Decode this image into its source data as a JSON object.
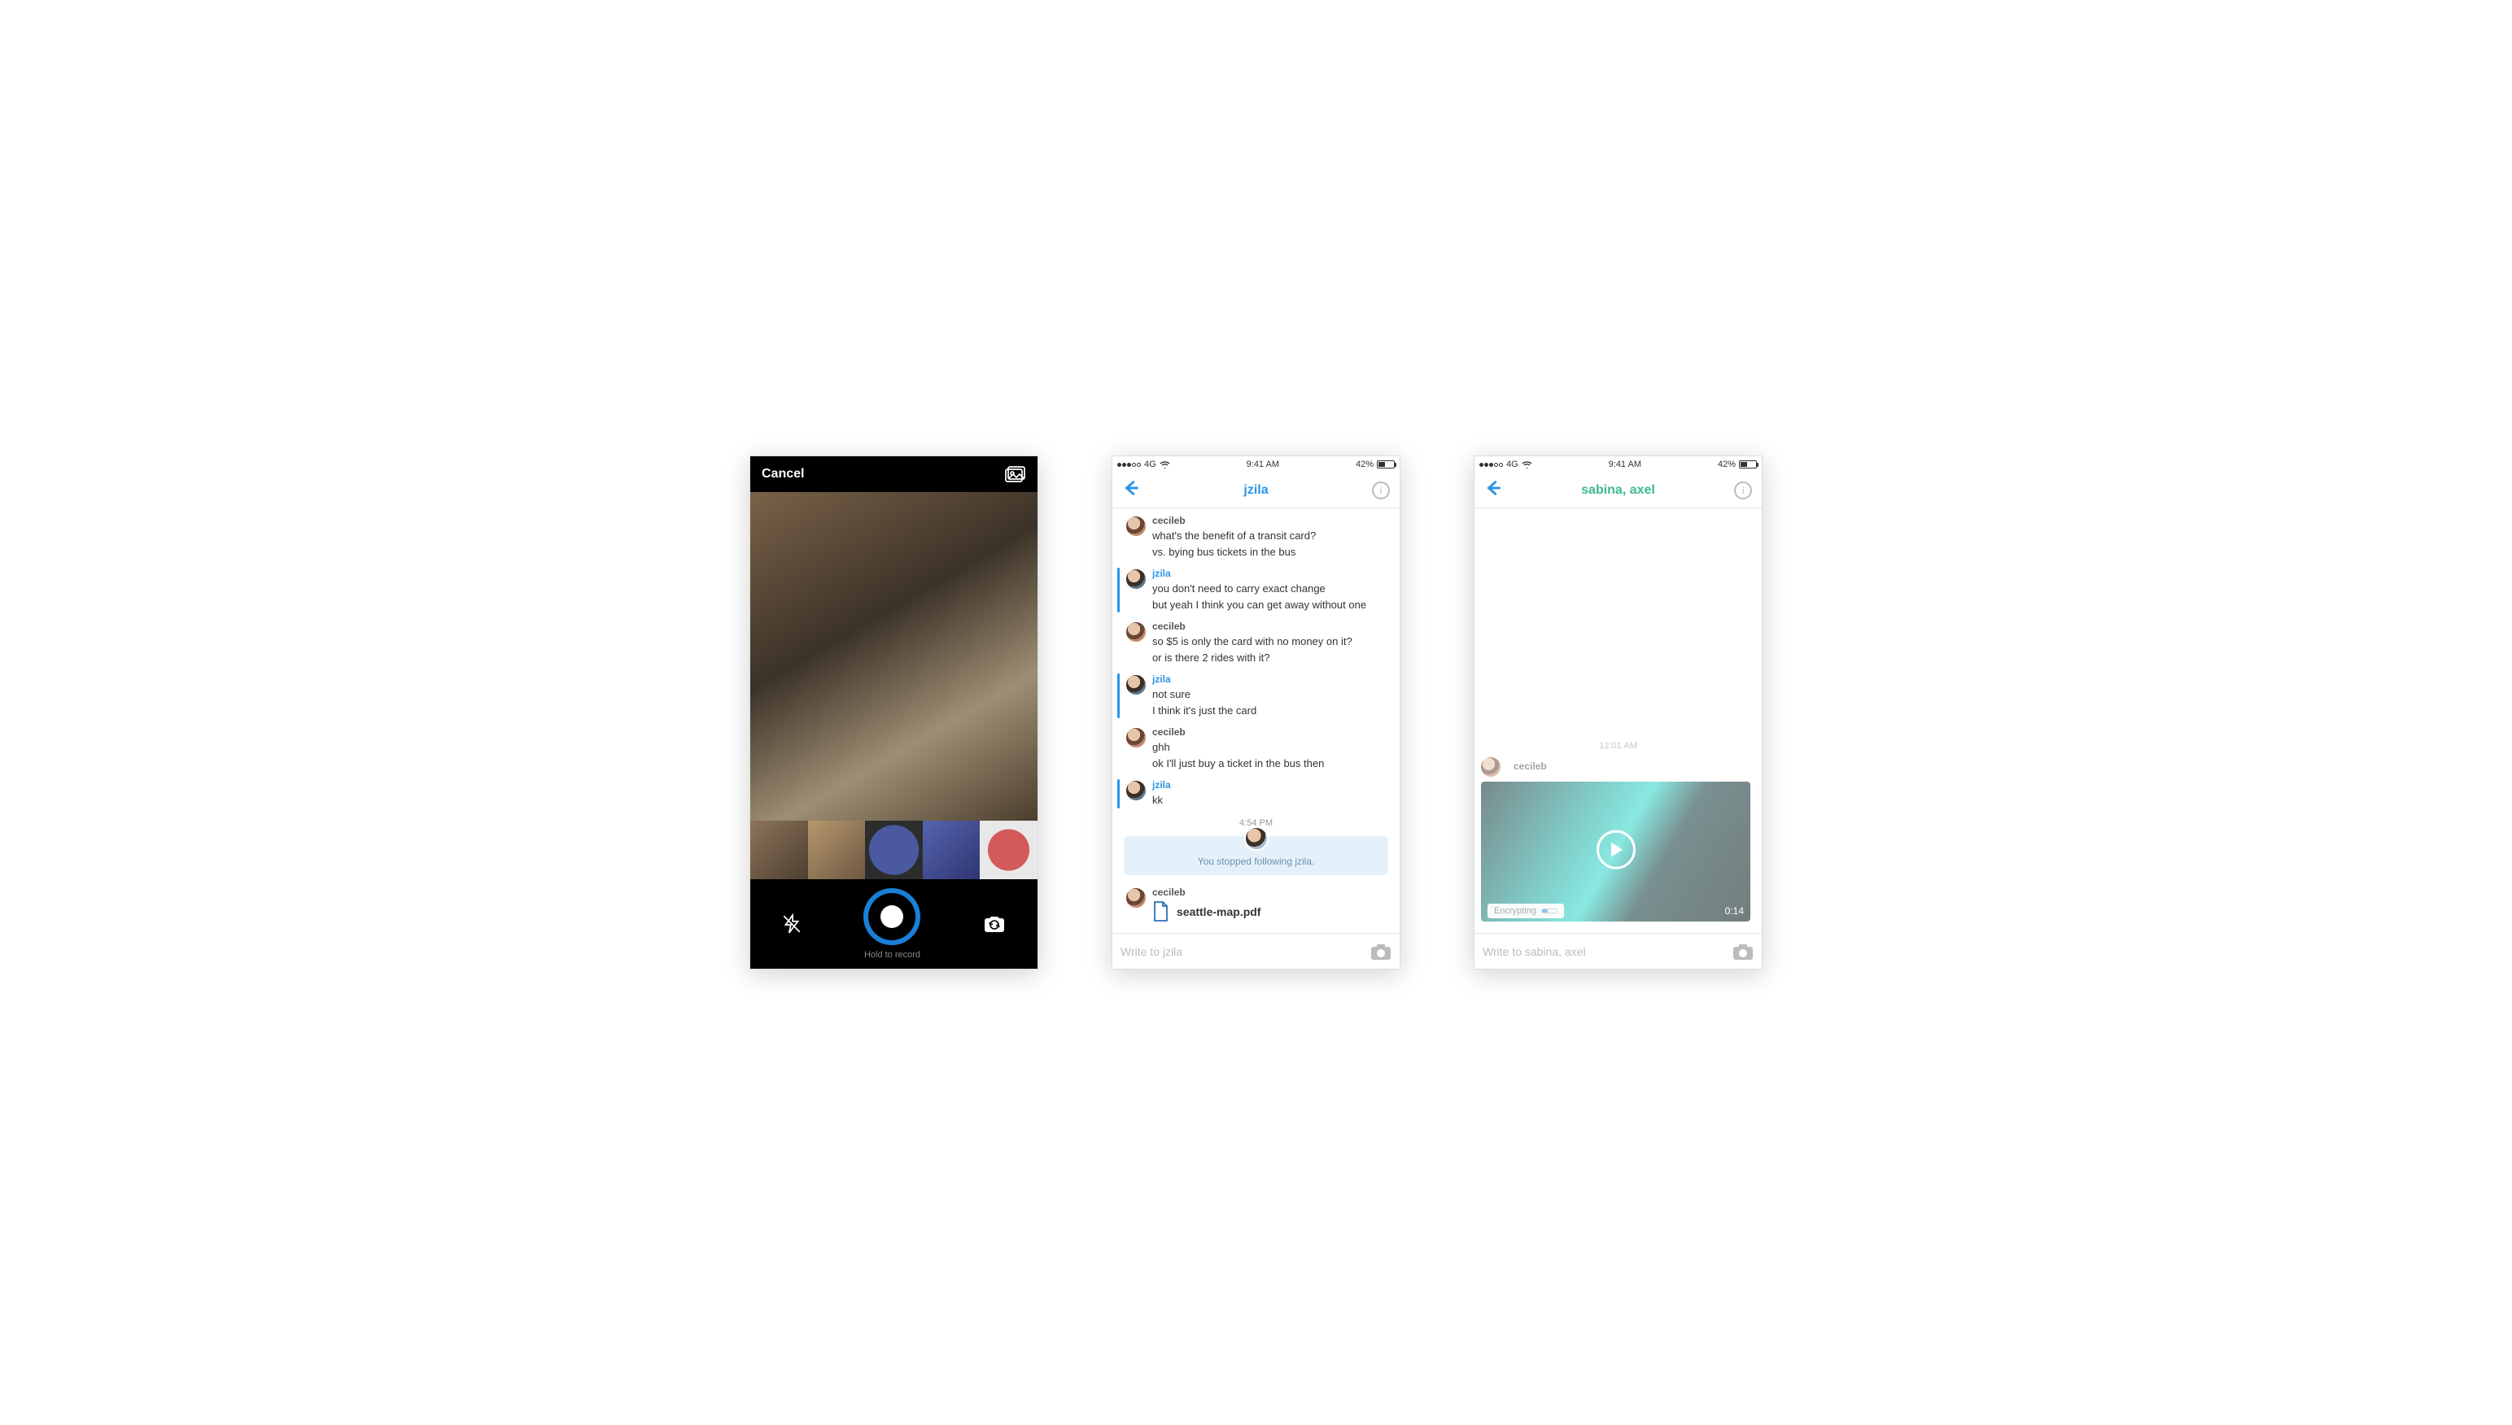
{
  "status": {
    "carrier": "4G",
    "time": "9:41 AM",
    "battery_pct": "42%"
  },
  "screenA": {
    "cancel": "Cancel",
    "hold_to_record": "Hold to record"
  },
  "screenB": {
    "title": "jzila",
    "timestamp": "4:54 PM",
    "system_msg": "You stopped following jzila.",
    "file_name": "seattle-map.pdf",
    "composer_placeholder": "Write to jzila",
    "messages": [
      {
        "user": "cecileb",
        "kind": "cb",
        "lines": [
          "what's the benefit of a transit card?",
          "vs. bying bus tickets in the bus"
        ]
      },
      {
        "user": "jzila",
        "kind": "jz",
        "lines": [
          "you don't need to carry exact change",
          "but yeah I think you can get away without one"
        ]
      },
      {
        "user": "cecileb",
        "kind": "cb",
        "lines": [
          "so $5 is only the card with no money on it?",
          "or is there 2 rides with it?"
        ]
      },
      {
        "user": "jzila",
        "kind": "jz",
        "lines": [
          "not sure",
          "I think it's just the card"
        ]
      },
      {
        "user": "cecileb",
        "kind": "cb",
        "lines": [
          "ghh",
          "ok I'll just buy a ticket in the bus then"
        ]
      },
      {
        "user": "jzila",
        "kind": "jz",
        "lines": [
          "kk"
        ]
      }
    ],
    "file_sender": "cecileb"
  },
  "screenC": {
    "title": "sabina, axel",
    "timestamp": "12:01 AM",
    "sender": "cecileb",
    "encrypting_label": "Encrypting",
    "duration": "0:14",
    "composer_placeholder": "Write to sabina, axel"
  }
}
